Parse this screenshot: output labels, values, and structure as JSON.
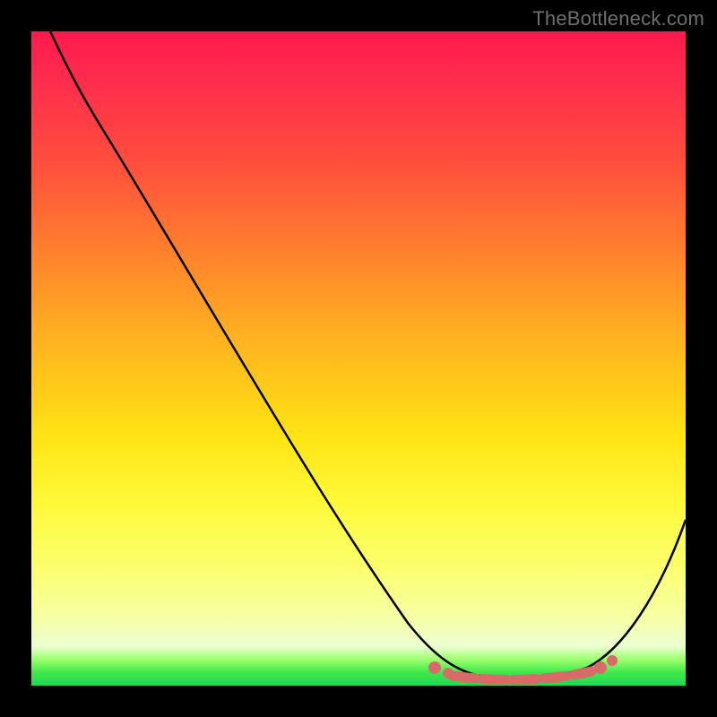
{
  "watermark": "TheBottleneck.com",
  "chart_data": {
    "type": "line",
    "title": "",
    "xlabel": "",
    "ylabel": "",
    "xlim": [
      0,
      100
    ],
    "ylim": [
      0,
      100
    ],
    "series": [
      {
        "name": "bottleneck-curve",
        "x": [
          3,
          7,
          12,
          18,
          25,
          32,
          40,
          48,
          55,
          61,
          65,
          68,
          72,
          76,
          80,
          84,
          88,
          92,
          96,
          100
        ],
        "values": [
          100,
          94,
          87,
          79,
          70,
          61,
          51,
          41,
          31,
          22,
          14,
          8,
          4,
          2,
          1,
          2,
          5,
          11,
          20,
          31
        ]
      }
    ],
    "marker_band": {
      "x_start": 62,
      "x_end": 90,
      "y": 2
    },
    "background_gradient": {
      "top": "#ff1a4d",
      "mid_upper": "#ff7a2e",
      "mid": "#ffe414",
      "lower": "#f6ffa8",
      "bottom": "#1fd856"
    }
  }
}
